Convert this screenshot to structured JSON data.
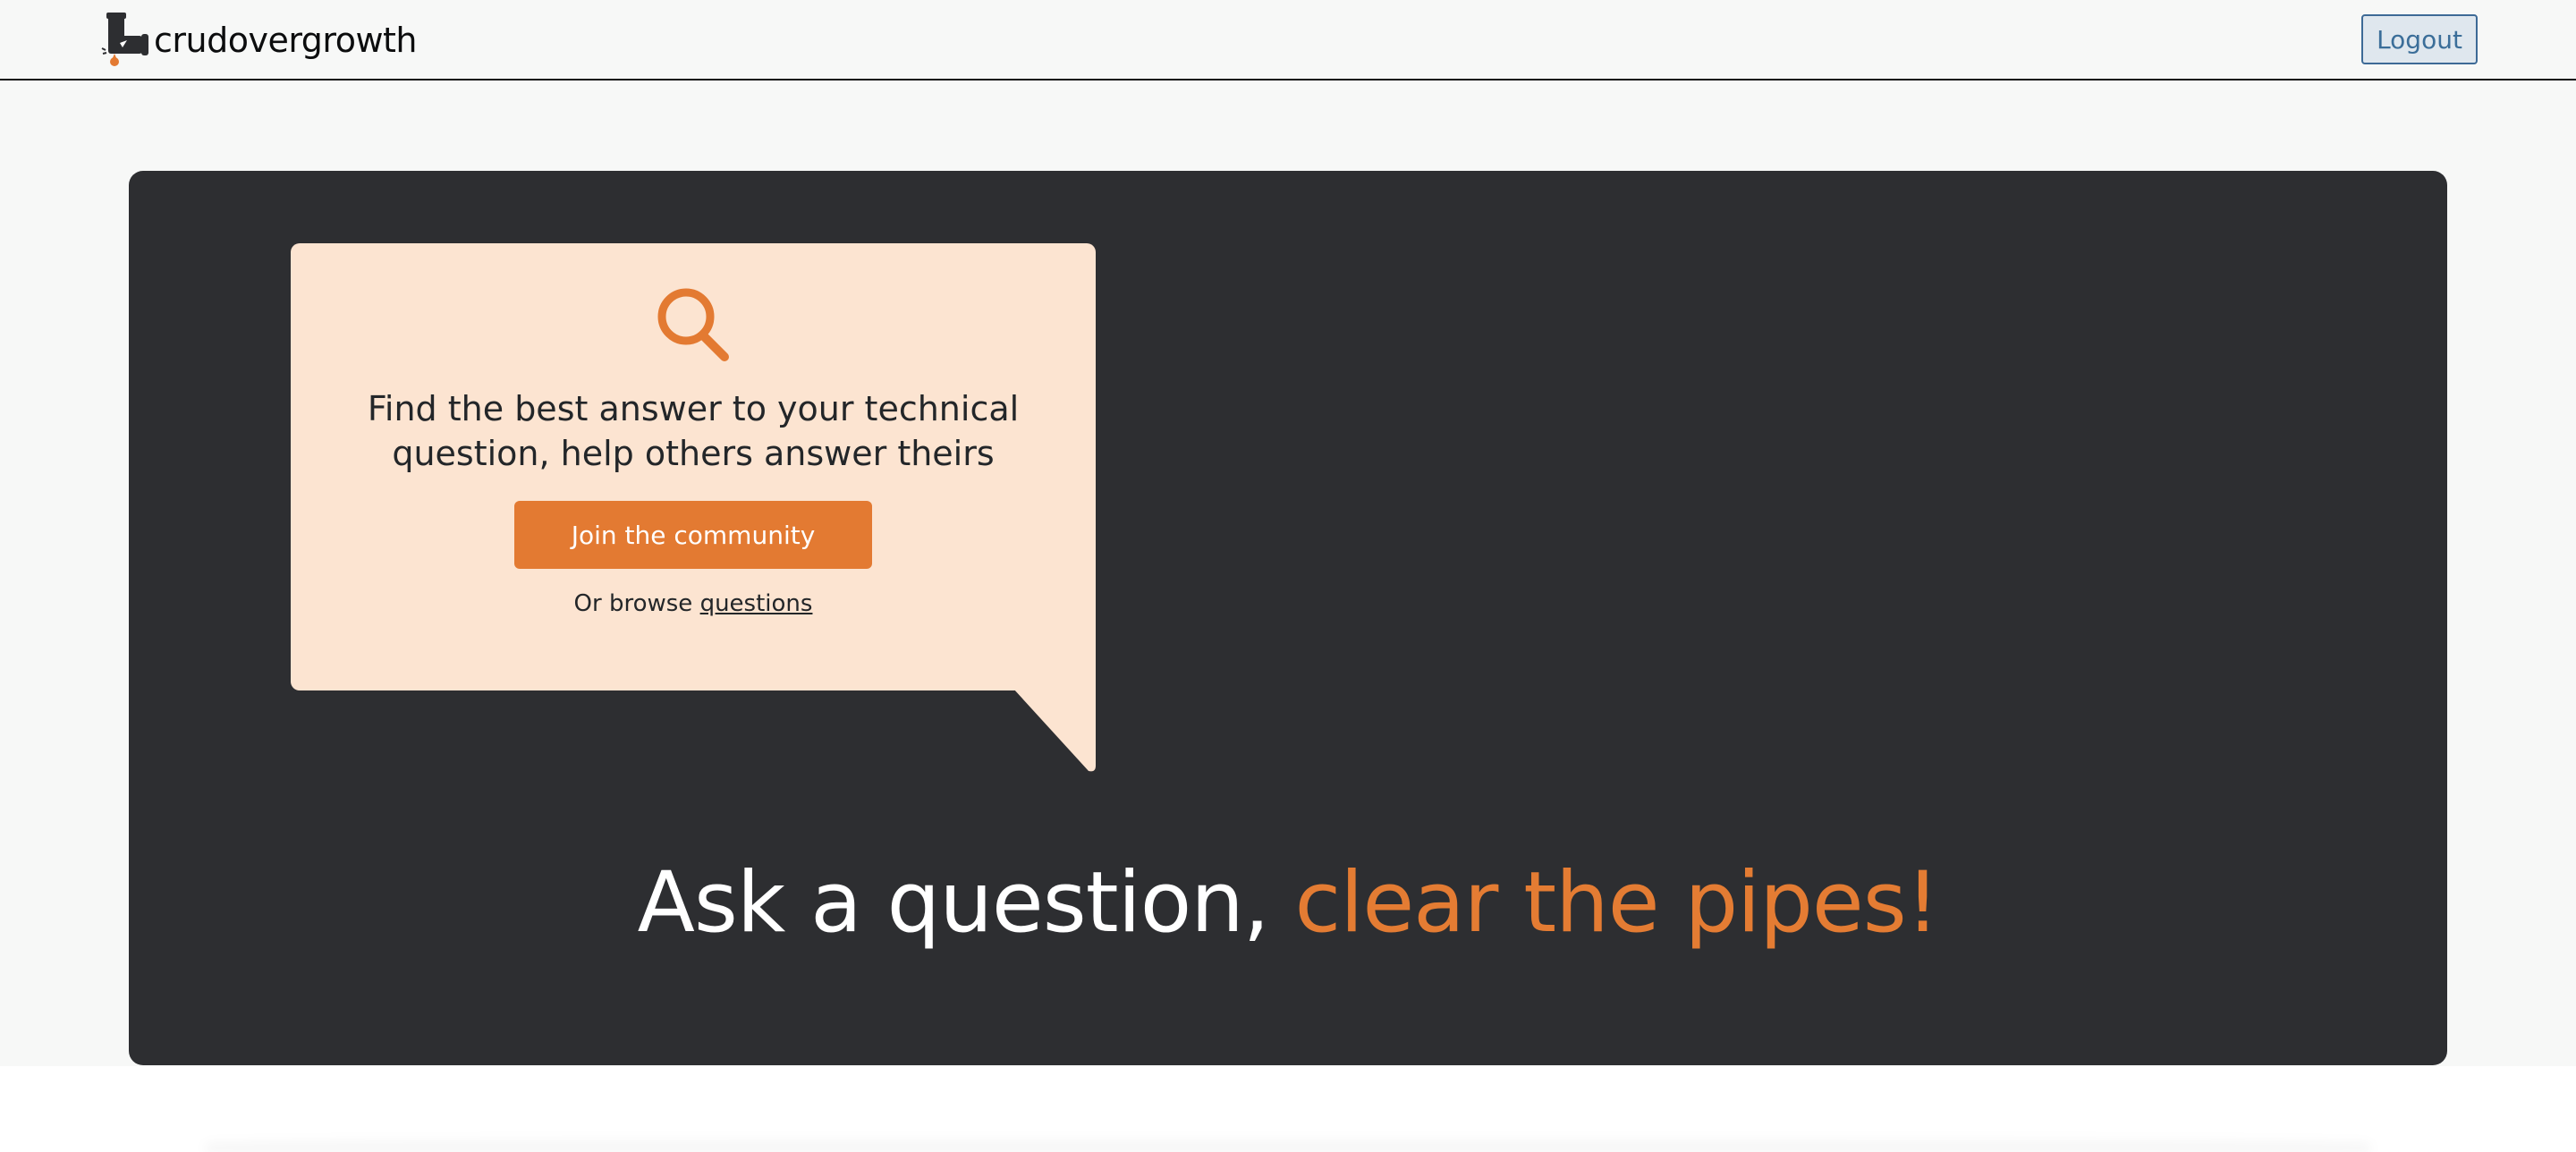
{
  "header": {
    "brand_name": "crudovergrowth",
    "logo_icon": "leaking-pipe-icon",
    "logout_label": "Logout"
  },
  "hero": {
    "search_icon": "search-icon",
    "title": "Find the best answer to your technical question, help others answer theirs",
    "join_label": "Join the community",
    "browse_prefix": "Or browse ",
    "browse_link": "questions",
    "headline_main": "Ask a question, ",
    "headline_accent": "clear the pipes!"
  },
  "colors": {
    "accent": "#e37a32",
    "hero_bg": "#2d2e31",
    "bubble_bg": "#fce4d1",
    "logout_border": "#3d6a96"
  }
}
